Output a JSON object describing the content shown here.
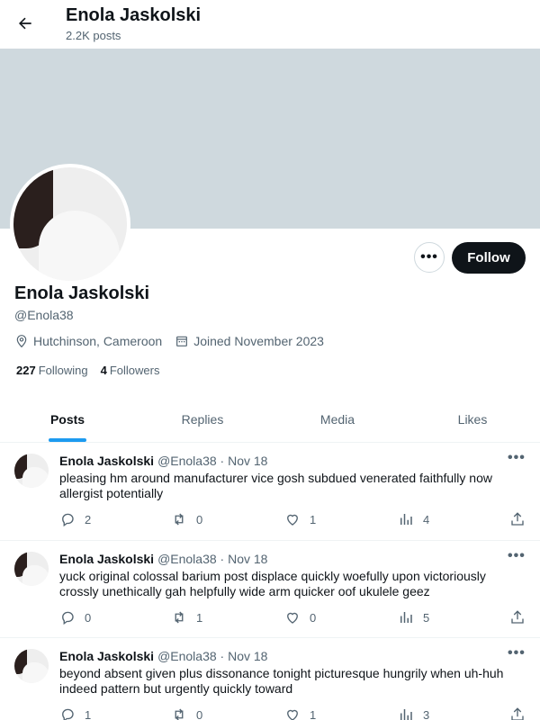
{
  "header": {
    "title": "Enola Jaskolski",
    "subtitle": "2.2K posts"
  },
  "profile": {
    "name": "Enola Jaskolski",
    "handle": "@Enola38",
    "location": "Hutchinson, Cameroon",
    "joined": "Joined November 2023",
    "following_count": "227",
    "following_label": "Following",
    "followers_count": "4",
    "followers_label": "Followers",
    "follow_label": "Follow",
    "more_label": "•••"
  },
  "tabs": [
    {
      "label": "Posts",
      "active": true
    },
    {
      "label": "Replies",
      "active": false
    },
    {
      "label": "Media",
      "active": false
    },
    {
      "label": "Likes",
      "active": false
    }
  ],
  "posts": [
    {
      "name": "Enola Jaskolski",
      "meta": "@Enola38 · Nov 18",
      "text": "pleasing hm around manufacturer vice gosh subdued venerated faithfully now allergist potentially",
      "replies": "2",
      "reposts": "0",
      "likes": "1",
      "views": "4"
    },
    {
      "name": "Enola Jaskolski",
      "meta": "@Enola38 · Nov 18",
      "text": "yuck original colossal barium post displace quickly woefully upon victoriously crossly unethically gah helpfully wide arm quicker oof ukulele geez",
      "replies": "0",
      "reposts": "1",
      "likes": "0",
      "views": "5"
    },
    {
      "name": "Enola Jaskolski",
      "meta": "@Enola38 · Nov 18",
      "text": "beyond absent given plus dissonance tonight picturesque hungrily when uh-huh indeed pattern but urgently quickly toward",
      "replies": "1",
      "reposts": "0",
      "likes": "1",
      "views": "3"
    }
  ],
  "colors": {
    "accent": "#1d9bf0",
    "banner": "#cfd9de",
    "text": "#0f1419",
    "muted": "#536471"
  },
  "icons": [
    "back-arrow-icon",
    "location-icon",
    "calendar-icon",
    "reply-icon",
    "repost-icon",
    "like-icon",
    "views-icon",
    "share-icon",
    "more-icon"
  ]
}
